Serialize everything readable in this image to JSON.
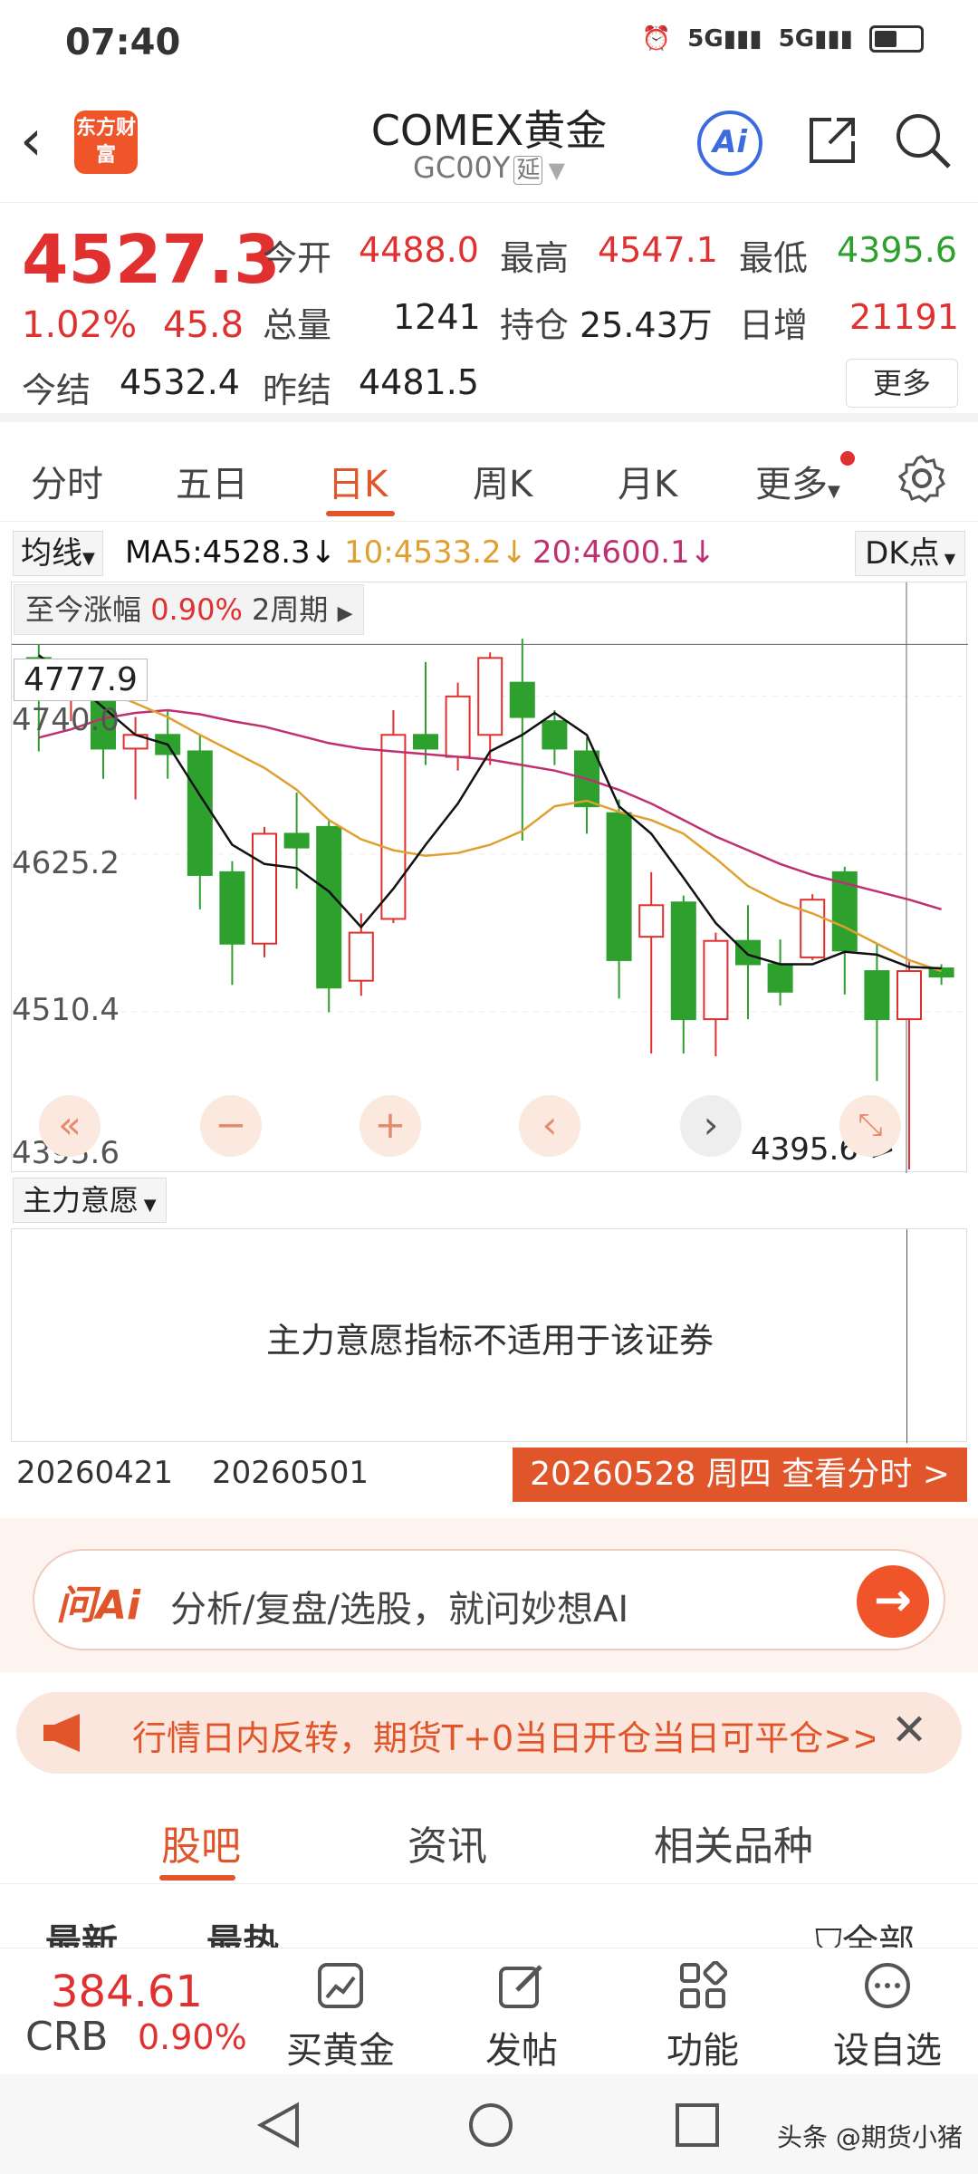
{
  "status": {
    "time": "07:40",
    "net1": "5G",
    "net2": "5G"
  },
  "header": {
    "title": "COMEX黄金",
    "code": "GC00Y",
    "delay_badge": "延",
    "logo_text": "东方财富",
    "ai_label": "Ai"
  },
  "quote": {
    "price": "4527.3",
    "change_pct": "1.02%",
    "change": "45.8",
    "open_label": "今开",
    "open": "4488.0",
    "high_label": "最高",
    "high": "4547.1",
    "low_label": "最低",
    "low": "4395.6",
    "volume_label": "总量",
    "volume": "1241",
    "oi_label": "持仓",
    "oi": "25.43万",
    "daily_inc_label": "日增",
    "daily_inc": "21191",
    "settle_label": "今结",
    "settle": "4532.4",
    "prev_settle_label": "昨结",
    "prev_settle": "4481.5",
    "more": "更多"
  },
  "tabs": [
    "分时",
    "五日",
    "日K",
    "周K",
    "月K",
    "更多"
  ],
  "ma": {
    "selector": "均线",
    "ma5": "MA5:4528.3↓",
    "ma10": "10:4533.2↓",
    "ma20": "20:4600.1↓",
    "dk": "DK点"
  },
  "chart_meta": {
    "range_label": "至今涨幅",
    "range_pct": "0.90%",
    "range_period": "2周期",
    "max_box": "4777.9",
    "low_marker": "4395.6->"
  },
  "chart_data": {
    "type": "candlestick",
    "y_labels": [
      "4740.0",
      "4625.2",
      "4510.4",
      "4395.6"
    ],
    "ylim": [
      4395.6,
      4790
    ],
    "series_names": [
      "MA5",
      "MA10",
      "MA20"
    ],
    "candles": [
      {
        "o": 4768,
        "c": 4742,
        "h": 4778,
        "l": 4700
      },
      {
        "o": 4740,
        "c": 4752,
        "h": 4765,
        "l": 4722
      },
      {
        "o": 4742,
        "c": 4702,
        "h": 4750,
        "l": 4680
      },
      {
        "o": 4702,
        "c": 4712,
        "h": 4725,
        "l": 4665
      },
      {
        "o": 4712,
        "c": 4698,
        "h": 4730,
        "l": 4680
      },
      {
        "o": 4700,
        "c": 4610,
        "h": 4712,
        "l": 4585
      },
      {
        "o": 4612,
        "c": 4560,
        "h": 4620,
        "l": 4530
      },
      {
        "o": 4560,
        "c": 4640,
        "h": 4645,
        "l": 4550
      },
      {
        "o": 4640,
        "c": 4630,
        "h": 4670,
        "l": 4600
      },
      {
        "o": 4645,
        "c": 4528,
        "h": 4650,
        "l": 4510
      },
      {
        "o": 4533,
        "c": 4568,
        "h": 4582,
        "l": 4522
      },
      {
        "o": 4578,
        "c": 4712,
        "h": 4730,
        "l": 4575
      },
      {
        "o": 4712,
        "c": 4702,
        "h": 4765,
        "l": 4690
      },
      {
        "o": 4696,
        "c": 4740,
        "h": 4750,
        "l": 4686
      },
      {
        "o": 4712,
        "c": 4768,
        "h": 4772,
        "l": 4690
      },
      {
        "o": 4750,
        "c": 4725,
        "h": 4782,
        "l": 4635
      },
      {
        "o": 4722,
        "c": 4702,
        "h": 4730,
        "l": 4690
      },
      {
        "o": 4700,
        "c": 4660,
        "h": 4710,
        "l": 4640
      },
      {
        "o": 4655,
        "c": 4548,
        "h": 4665,
        "l": 4520
      },
      {
        "o": 4565,
        "c": 4588,
        "h": 4612,
        "l": 4480
      },
      {
        "o": 4590,
        "c": 4505,
        "h": 4595,
        "l": 4480
      },
      {
        "o": 4505,
        "c": 4562,
        "h": 4568,
        "l": 4478
      },
      {
        "o": 4562,
        "c": 4545,
        "h": 4588,
        "l": 4505
      },
      {
        "o": 4545,
        "c": 4525,
        "h": 4563,
        "l": 4515
      },
      {
        "o": 4550,
        "c": 4592,
        "h": 4596,
        "l": 4548
      },
      {
        "o": 4612,
        "c": 4555,
        "h": 4616,
        "l": 4523
      },
      {
        "o": 4540,
        "c": 4505,
        "h": 4560,
        "l": 4460
      },
      {
        "o": 4505,
        "c": 4540,
        "h": 4547,
        "l": 4395.6
      },
      {
        "o": 4542,
        "c": 4536,
        "h": 4545,
        "l": 4530
      }
    ],
    "ma5": [
      4770,
      4752,
      4732,
      4712,
      4705,
      4668,
      4632,
      4618,
      4615,
      4598,
      4572,
      4600,
      4632,
      4662,
      4700,
      4712,
      4728,
      4712,
      4660,
      4640,
      4608,
      4575,
      4552,
      4545,
      4545,
      4554,
      4552,
      4543,
      4542
    ],
    "ma10": [
      4765,
      4755,
      4745,
      4735,
      4725,
      4712,
      4700,
      4688,
      4672,
      4650,
      4636,
      4628,
      4624,
      4626,
      4632,
      4642,
      4660,
      4664,
      4656,
      4650,
      4640,
      4622,
      4602,
      4590,
      4582,
      4572,
      4560,
      4548,
      4540
    ],
    "ma20": [
      4710,
      4716,
      4724,
      4728,
      4730,
      4727,
      4722,
      4718,
      4712,
      4706,
      4702,
      4700,
      4698,
      4696,
      4694,
      4690,
      4686,
      4680,
      4672,
      4662,
      4650,
      4638,
      4628,
      4618,
      4610,
      4604,
      4598,
      4592,
      4585
    ]
  },
  "controls": {
    "fast_back": "«",
    "zoom_out": "−",
    "zoom_in": "+",
    "prev": "‹",
    "next": "›",
    "expand": "⤡"
  },
  "indicator": {
    "selector": "主力意愿",
    "message": "主力意愿指标不适用于该证券"
  },
  "dates": {
    "d1": "20260421",
    "d2": "20260501",
    "selected": "20260528 周四 查看分时 >"
  },
  "ask_ai": {
    "logo": "问Ai",
    "placeholder": "分析/复盘/选股，就问妙想AI"
  },
  "notice": {
    "text": "行情日内反转，期货T+0当日开仓当日可平仓>>"
  },
  "bottom_tabs": [
    "股吧",
    "资讯",
    "相关品种"
  ],
  "sort": {
    "latest": "最新",
    "hot": "最热",
    "all": "全部"
  },
  "toolbar": {
    "crb_value": "384.61",
    "crb_name": "CRB",
    "crb_pct": "0.90%",
    "buy": "买黄金",
    "post": "发帖",
    "func": "功能",
    "watch": "设自选"
  },
  "watermark": "头条 @期货小猪",
  "colors": {
    "up": "#e03030",
    "down": "#2ea02e",
    "accent": "#e0552a",
    "ma5": "#111111",
    "ma10": "#e0a030",
    "ma20": "#c03070"
  }
}
